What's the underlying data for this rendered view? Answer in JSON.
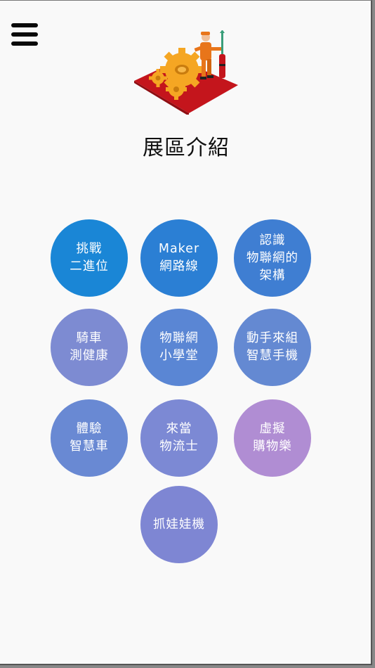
{
  "header": {
    "menu_icon": "hamburger-menu-icon",
    "hero_icon": "engineer-with-gears-illustration",
    "title": "展區介紹"
  },
  "zones": [
    {
      "label": "挑戰\n二進位",
      "color": "#1a86d6"
    },
    {
      "label": "Maker\n網路線",
      "color": "#2b7fd4"
    },
    {
      "label": "認識\n物聯網的\n架構",
      "color": "#3f7ed2"
    },
    {
      "label": "騎車\n測健康",
      "color": "#7d8bd2"
    },
    {
      "label": "物聯網\n小學堂",
      "color": "#5a86d4"
    },
    {
      "label": "動手來組\n智慧手機",
      "color": "#6489d2"
    },
    {
      "label": "體驗\n智慧車",
      "color": "#6989d3"
    },
    {
      "label": "來當\n物流士",
      "color": "#7c89d4"
    },
    {
      "label": "虛擬\n購物樂",
      "color": "#b08dd3"
    },
    {
      "label": "抓娃娃機",
      "color": "#7e86d3"
    }
  ]
}
